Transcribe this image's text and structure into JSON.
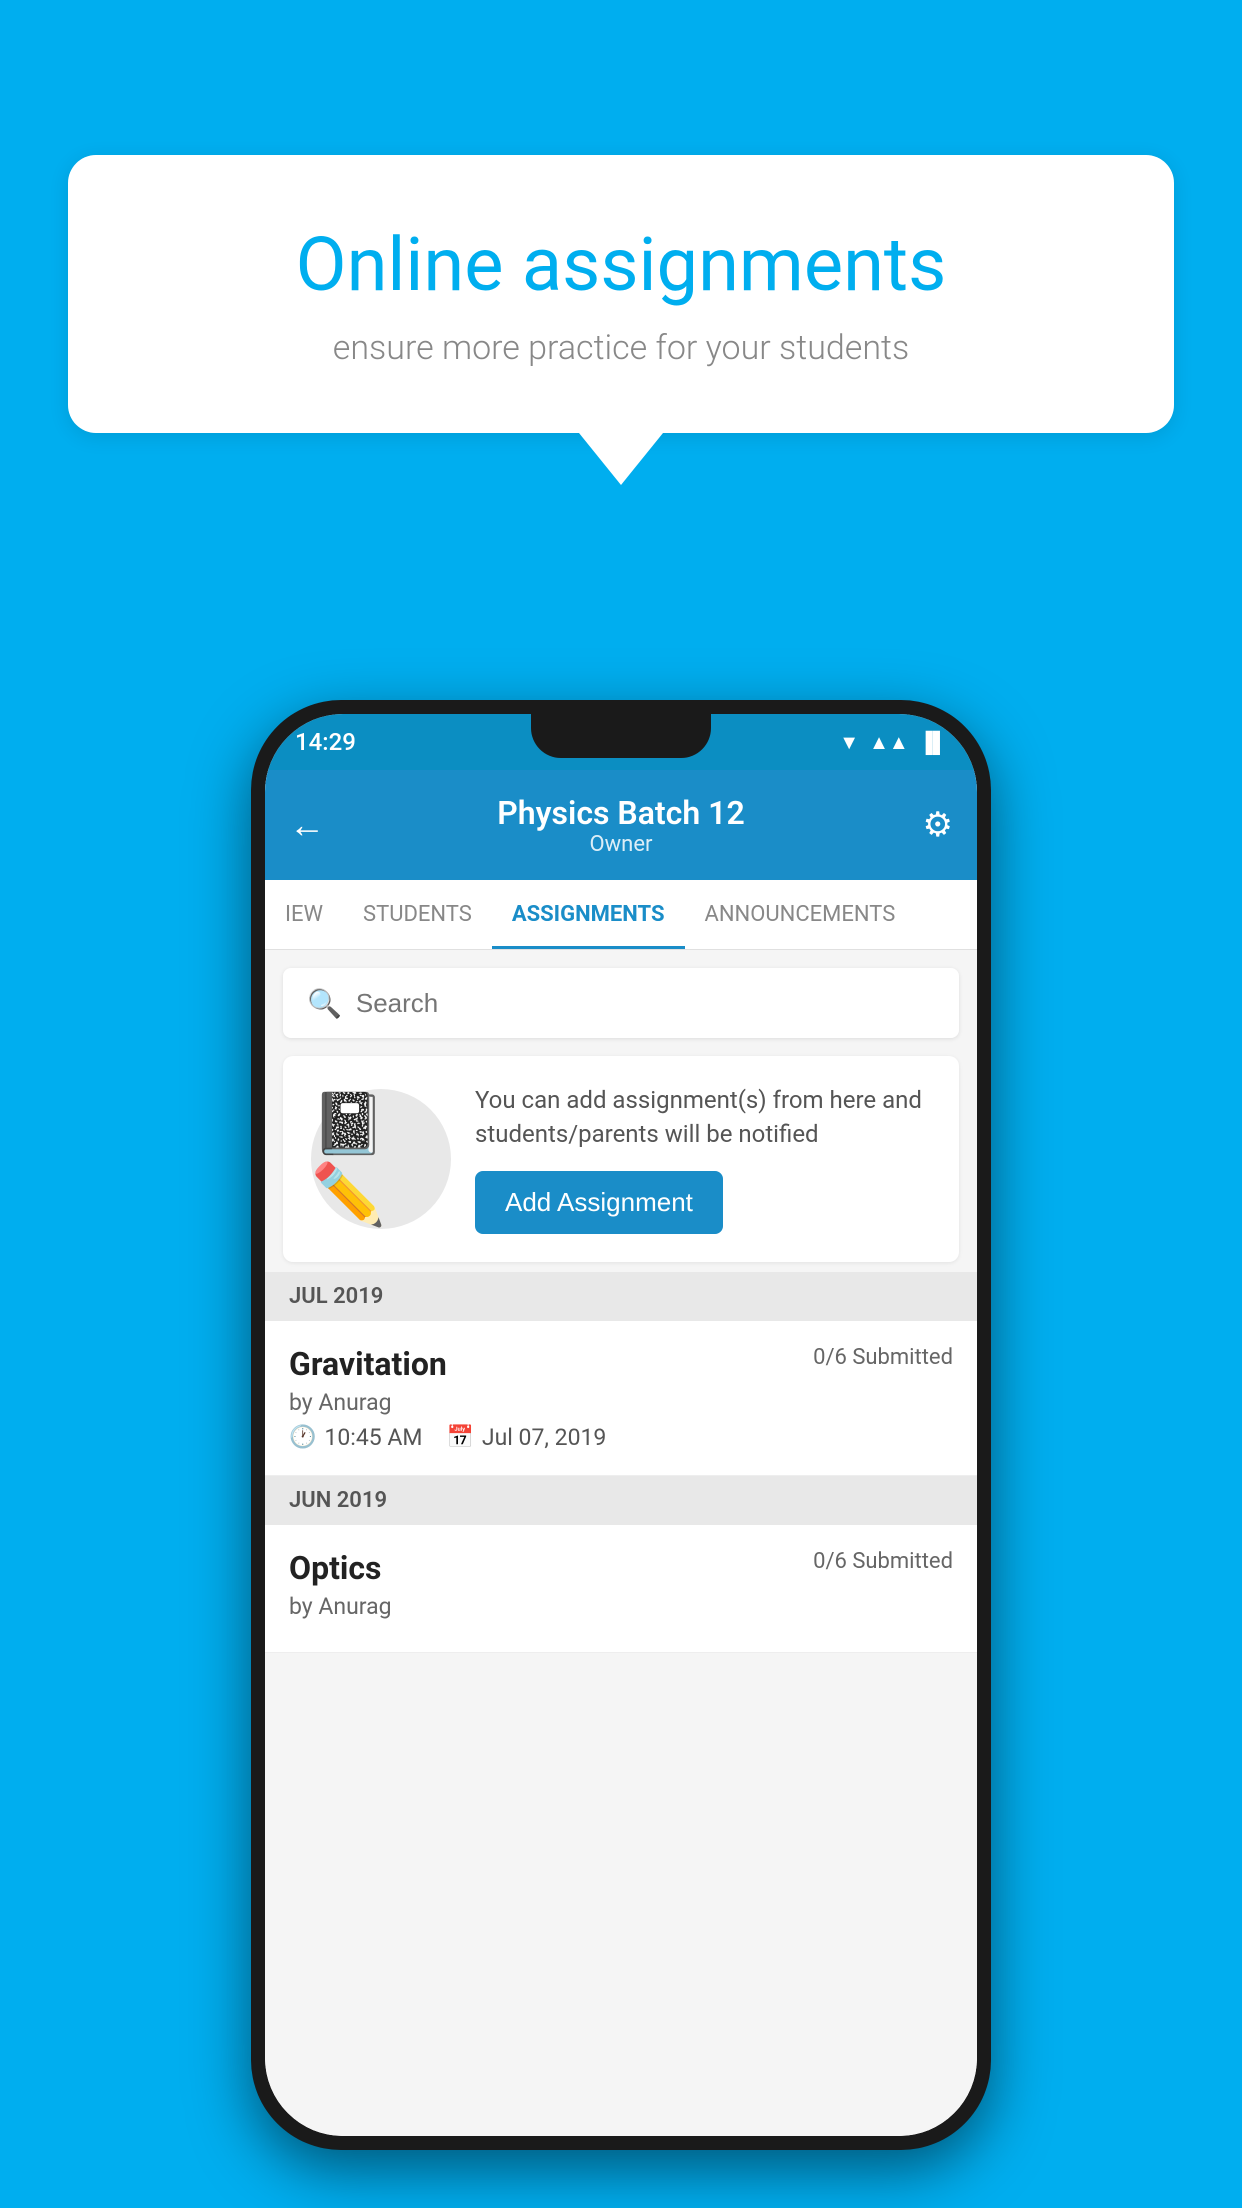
{
  "background_color": "#00AEEF",
  "speech_bubble": {
    "title": "Online assignments",
    "subtitle": "ensure more practice for your students"
  },
  "phone": {
    "status_bar": {
      "time": "14:29",
      "wifi_icon": "▾",
      "signal_icon": "▲",
      "battery_icon": "▐"
    },
    "header": {
      "title": "Physics Batch 12",
      "subtitle": "Owner",
      "back_icon": "←",
      "gear_icon": "⚙"
    },
    "tabs": [
      {
        "label": "IEW",
        "active": false
      },
      {
        "label": "STUDENTS",
        "active": false
      },
      {
        "label": "ASSIGNMENTS",
        "active": true
      },
      {
        "label": "ANNOUNCEMENTS",
        "active": false
      }
    ],
    "search": {
      "placeholder": "Search"
    },
    "promo": {
      "text": "You can add assignment(s) from here and students/parents will be notified",
      "button_label": "Add Assignment"
    },
    "sections": [
      {
        "month": "JUL 2019",
        "assignments": [
          {
            "name": "Gravitation",
            "submitted": "0/6 Submitted",
            "author": "by Anurag",
            "time": "10:45 AM",
            "date": "Jul 07, 2019"
          }
        ]
      },
      {
        "month": "JUN 2019",
        "assignments": [
          {
            "name": "Optics",
            "submitted": "0/6 Submitted",
            "author": "by Anurag",
            "time": "",
            "date": ""
          }
        ]
      }
    ]
  }
}
